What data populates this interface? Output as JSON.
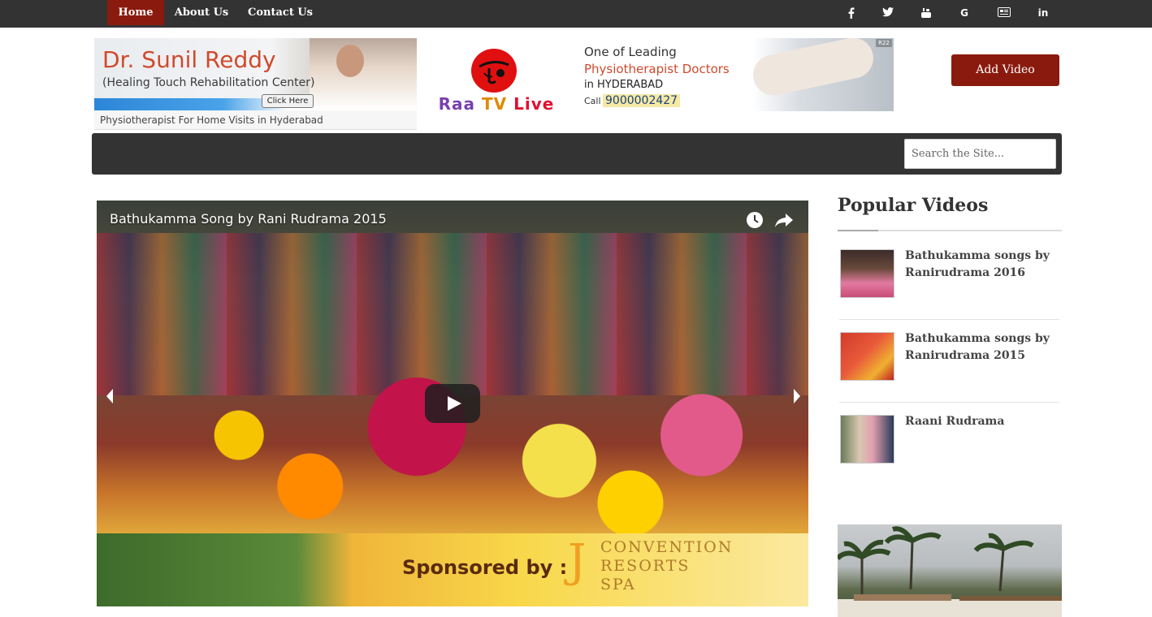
{
  "nav": {
    "items": [
      {
        "label": "Home",
        "active": true
      },
      {
        "label": "About Us",
        "active": false
      },
      {
        "label": "Contact Us",
        "active": false
      }
    ],
    "social_icons": [
      "facebook-icon",
      "twitter-icon",
      "youtube-icon",
      "google-icon",
      "rss-icon",
      "linkedin-icon"
    ],
    "google_glyph": "G",
    "linkedin_glyph": "in"
  },
  "header": {
    "left_ad": {
      "title": "Dr. Sunil Reddy",
      "subtitle": "(Healing Touch Rehabilitation Center)",
      "button": "Click Here",
      "caption": "Physiotherapist For Home Visits in Hyderabad"
    },
    "logo": {
      "raa": "Raa",
      "tv": "TV",
      "live": "Live"
    },
    "right_ad": {
      "line1": "One of Leading",
      "line2": "Physiotherapist Doctors",
      "line3": "in HYDERABAD",
      "call": "Call",
      "phone": "9000002427",
      "badge": "R22"
    },
    "add_video_label": "Add Video"
  },
  "search": {
    "placeholder": "Search the Site..."
  },
  "video": {
    "title": "Bathukamma Song by Rani Rudrama 2015",
    "sponsor_text": "Sponsored by :",
    "sponsor_letter": "J",
    "sponsor_brand": [
      "CONVENTION",
      "RESORTS",
      "SPA"
    ]
  },
  "sidebar": {
    "title": "Popular Videos",
    "items": [
      {
        "label": "Bathukamma songs by Ranirudrama 2016"
      },
      {
        "label": "Bathukamma songs by Ranirudrama 2015"
      },
      {
        "label": "Raani Rudrama"
      }
    ]
  },
  "colors": {
    "nav_bg": "#333333",
    "accent": "#8b1a0e",
    "text_dark": "#333333"
  }
}
